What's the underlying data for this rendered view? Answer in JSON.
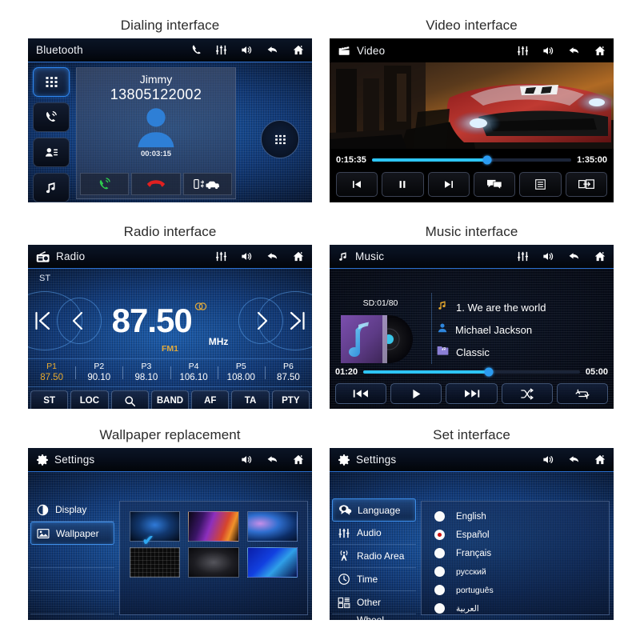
{
  "panels": {
    "dialing": {
      "caption": "Dialing interface",
      "topbar": {
        "title": "Bluetooth",
        "icons": [
          "phone-icon",
          "equalizer-icon",
          "volume-icon",
          "back-icon",
          "home-icon"
        ]
      },
      "sidebar": [
        {
          "name": "keypad",
          "selected": true
        },
        {
          "name": "call-log",
          "selected": false
        },
        {
          "name": "contacts",
          "selected": false
        },
        {
          "name": "music",
          "selected": false
        }
      ],
      "contact_name": "Jimmy",
      "phone_number": "13805122002",
      "call_duration": "00:03:15",
      "actions": [
        "answer-call",
        "end-call",
        "transfer-audio"
      ],
      "keypad_button": "dial-pad"
    },
    "video": {
      "caption": "Video interface",
      "topbar": {
        "title": "Video",
        "icons": [
          "equalizer-icon",
          "volume-icon",
          "back-icon",
          "home-icon"
        ]
      },
      "elapsed": "0:15:35",
      "total": "1:35:00",
      "progress_percent": 58,
      "controls": [
        "previous",
        "pause",
        "next",
        "subtitle",
        "list",
        "screen-switch"
      ]
    },
    "radio": {
      "caption": "Radio interface",
      "topbar": {
        "title": "Radio",
        "icons": [
          "equalizer-icon",
          "volume-icon",
          "back-icon",
          "home-icon"
        ]
      },
      "stereo_indicator": "ST",
      "frequency": "87.50",
      "unit": "MHz",
      "band": "FM1",
      "presets": [
        {
          "label": "P1",
          "value": "87.50",
          "active": true
        },
        {
          "label": "P2",
          "value": "90.10",
          "active": false
        },
        {
          "label": "P3",
          "value": "98.10",
          "active": false
        },
        {
          "label": "P4",
          "value": "106.10",
          "active": false
        },
        {
          "label": "P5",
          "value": "108.00",
          "active": false
        },
        {
          "label": "P6",
          "value": "87.50",
          "active": false
        }
      ],
      "buttons": [
        "ST",
        "LOC",
        "",
        "BAND",
        "AF",
        "TA",
        "PTY"
      ],
      "search_button_icon": "search-icon"
    },
    "music": {
      "caption": "Music interface",
      "topbar": {
        "title": "Music",
        "icons": [
          "equalizer-icon",
          "volume-icon",
          "back-icon",
          "home-icon"
        ]
      },
      "source": "SD:01/80",
      "track": "1.  We are the world",
      "artist": "Michael Jackson",
      "genre": "Classic",
      "elapsed": "01:20",
      "total": "05:00",
      "progress_percent": 58,
      "controls": [
        "previous-track",
        "play",
        "next-track",
        "shuffle",
        "repeat"
      ]
    },
    "wallpaper": {
      "caption": "Wallpaper replacement",
      "topbar": {
        "title": "Settings",
        "icons": [
          "volume-icon",
          "back-icon",
          "home-icon"
        ]
      },
      "menu": [
        {
          "label": "Display",
          "icon": "contrast-icon",
          "active": false
        },
        {
          "label": "Wallpaper",
          "icon": "image-icon",
          "active": true
        },
        {
          "label": "",
          "icon": "",
          "active": false
        },
        {
          "label": "",
          "icon": "",
          "active": false
        },
        {
          "label": "",
          "icon": "",
          "active": false
        },
        {
          "label": "",
          "icon": "",
          "active": false
        }
      ],
      "thumbnails": [
        {
          "id": "wp-1",
          "selected": true
        },
        {
          "id": "wp-2",
          "selected": false
        },
        {
          "id": "wp-3",
          "selected": false
        },
        {
          "id": "wp-4",
          "selected": false
        },
        {
          "id": "wp-5",
          "selected": false
        },
        {
          "id": "wp-6",
          "selected": false
        }
      ],
      "selected_mark": "✔"
    },
    "settings": {
      "caption": "Set interface",
      "topbar": {
        "title": "Settings",
        "icons": [
          "volume-icon",
          "back-icon",
          "home-icon"
        ]
      },
      "menu": [
        {
          "label": "Language",
          "icon": "speech-bubble-icon",
          "active": true
        },
        {
          "label": "Audio",
          "icon": "equalizer-icon",
          "active": false
        },
        {
          "label": "Radio Area",
          "icon": "antenna-icon",
          "active": false
        },
        {
          "label": "Time",
          "icon": "clock-icon",
          "active": false
        },
        {
          "label": "Other",
          "icon": "grid-icon",
          "active": false
        },
        {
          "label": "Wheel Control",
          "icon": "steering-wheel-icon",
          "active": false
        }
      ],
      "languages": [
        {
          "label": "English",
          "selected": false
        },
        {
          "label": "Español",
          "selected": true
        },
        {
          "label": "Français",
          "selected": false
        },
        {
          "label": "русский",
          "selected": false
        },
        {
          "label": "português",
          "selected": false
        },
        {
          "label": "العربية",
          "selected": false
        }
      ]
    }
  },
  "colors": {
    "accent_blue": "#2b9bf0",
    "preset_active": "#e8aa2e",
    "radio_selected": "#cf1111",
    "answer_green": "#2ecb4e",
    "end_red": "#e02020"
  }
}
